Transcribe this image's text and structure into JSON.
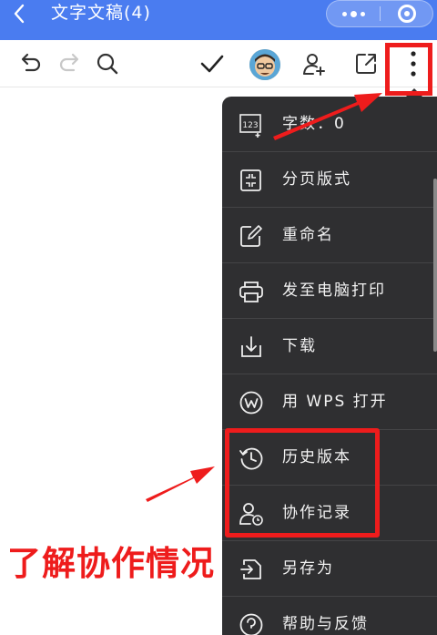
{
  "titlebar": {
    "back_icon": "chevron-left-icon",
    "title": "文字文稿(4)",
    "more_icon": "more-dots-icon",
    "close_icon": "target-close-icon"
  },
  "toolbar": {
    "icons": [
      "undo-icon",
      "redo-icon",
      "search-icon",
      "check-icon",
      "avatar",
      "add-user-icon",
      "share-icon",
      "more-vertical-icon"
    ]
  },
  "menu": {
    "items": [
      {
        "icon": "word-count-icon",
        "label": "字数：0"
      },
      {
        "icon": "page-layout-icon",
        "label": "分页版式"
      },
      {
        "icon": "rename-icon",
        "label": "重命名"
      },
      {
        "icon": "printer-icon",
        "label": "发至电脑打印"
      },
      {
        "icon": "download-icon",
        "label": "下载"
      },
      {
        "icon": "wps-icon",
        "label": "用 WPS 打开"
      },
      {
        "icon": "history-icon",
        "label": "历史版本"
      },
      {
        "icon": "collab-record-icon",
        "label": "协作记录"
      },
      {
        "icon": "save-as-icon",
        "label": "另存为"
      },
      {
        "icon": "help-icon",
        "label": "帮助与反馈"
      }
    ]
  },
  "annotation": {
    "callout": "了解协作情况",
    "color": "#ee1c1c"
  },
  "colors": {
    "titlebar": "#4a7cf0",
    "menu_bg": "#2f2f31"
  }
}
